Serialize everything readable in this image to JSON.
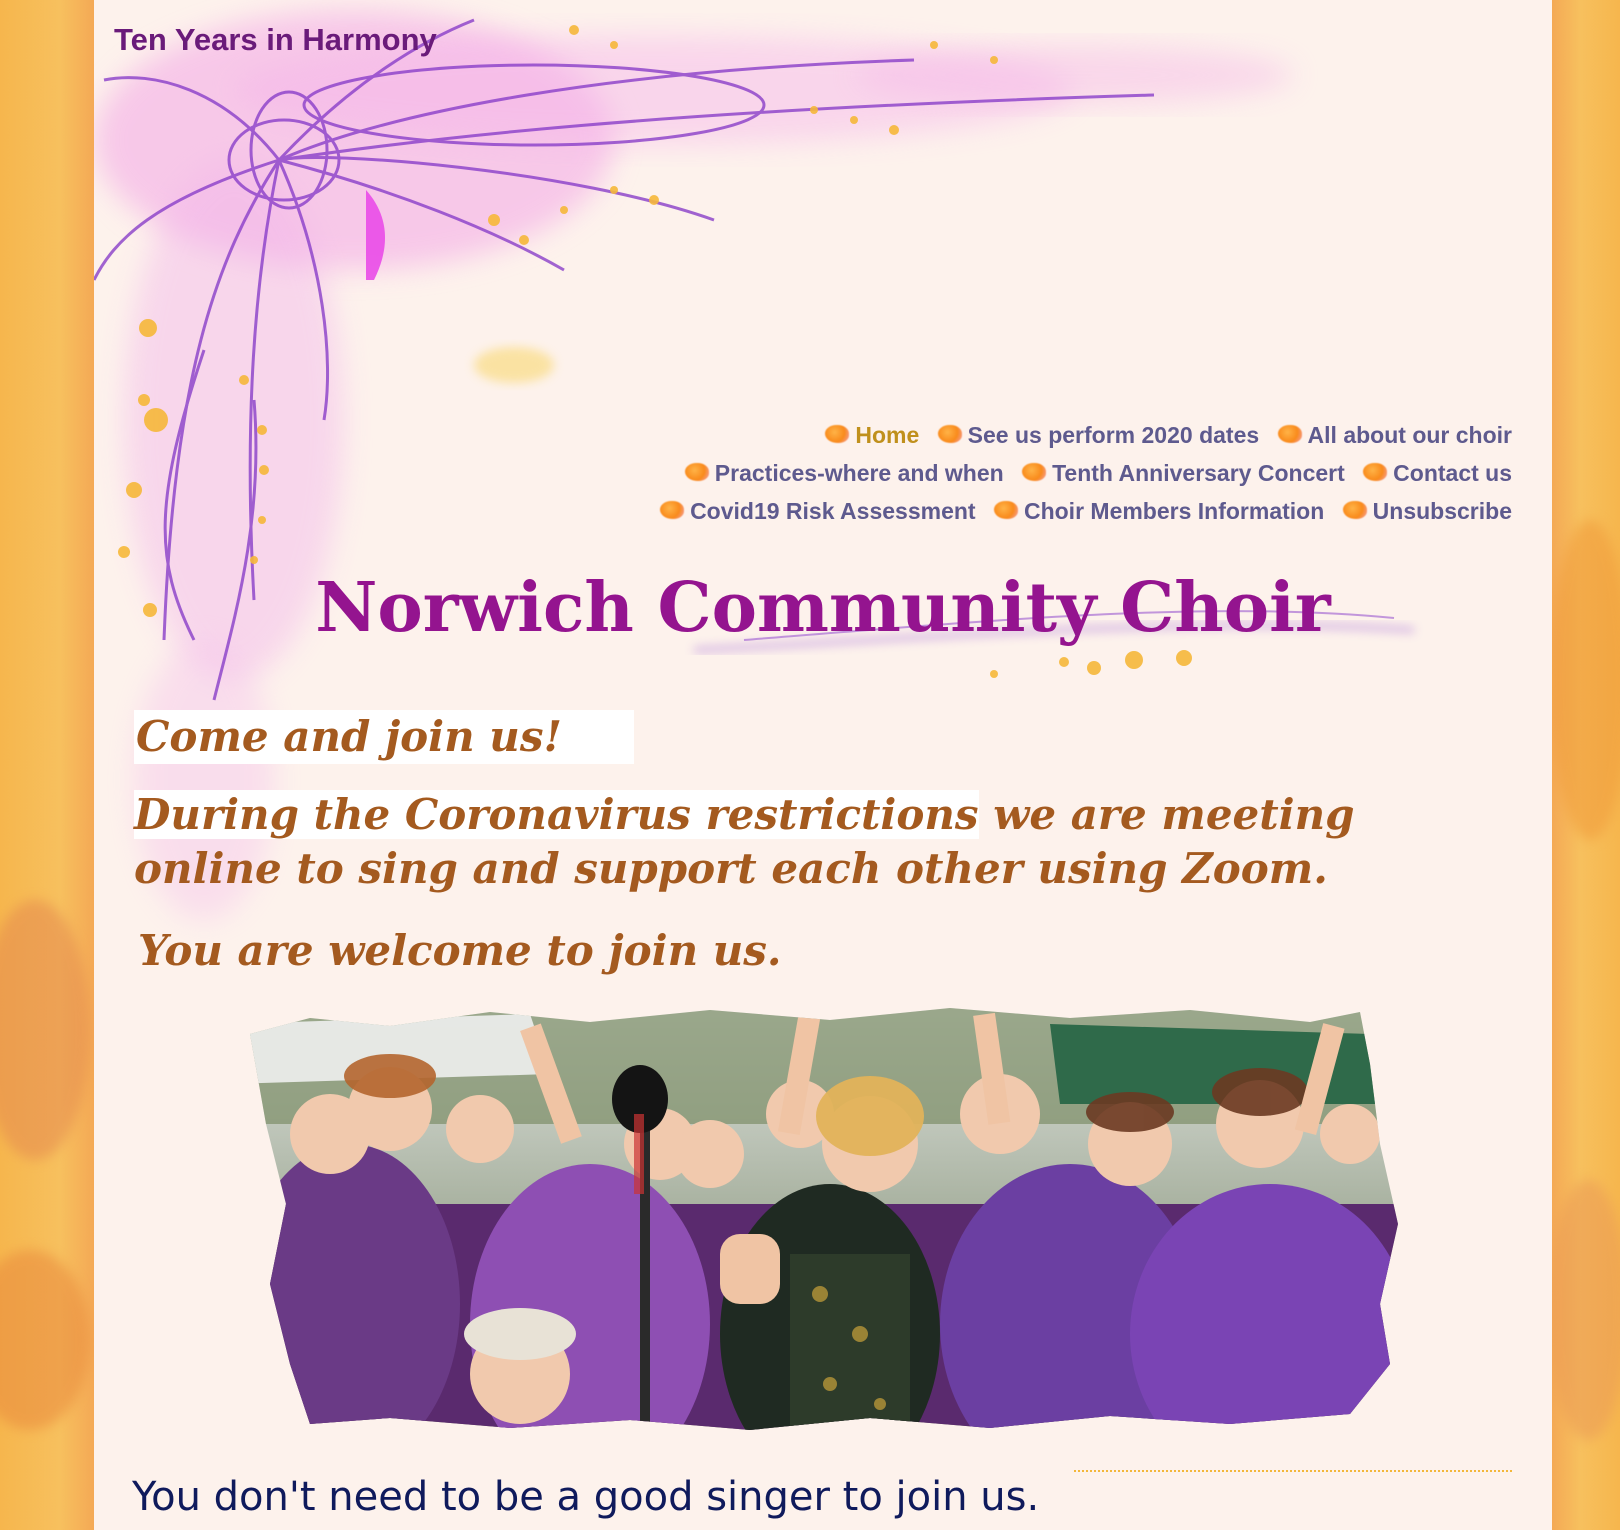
{
  "site": {
    "tagline": "Ten Years in Harmony"
  },
  "nav": {
    "items": [
      {
        "label": "Home",
        "active": true
      },
      {
        "label": "See us perform 2020 dates",
        "active": false
      },
      {
        "label": "All about our choir",
        "active": false
      },
      {
        "label": "Practices-where and when",
        "active": false
      },
      {
        "label": "Tenth Anniversary Concert",
        "active": false
      },
      {
        "label": "Contact us",
        "active": false
      },
      {
        "label": "Covid19 Risk Assessment",
        "active": false
      },
      {
        "label": "Choir Members Information",
        "active": false
      },
      {
        "label": "Unsubscribe",
        "active": false
      }
    ],
    "bullet_icon": "orange-blob-icon"
  },
  "main": {
    "title": "Norwich Community Choir",
    "come_join": "Come and join us!",
    "covid_highlight": "During the Coronavirus restrictions",
    "covid_rest": " we are meeting online to sing and support each other using Zoom.",
    "welcome": "You are welcome to join us.",
    "photo": "choir-photo",
    "lead_text": "You don't need to be a good singer to join us."
  },
  "colors": {
    "title": "#94148f",
    "nav_link": "#5e5a8e",
    "nav_active": "#c0901c",
    "intro_text": "#a45a1f",
    "page_bg": "#fdf2ec",
    "outer_bg": "#f6b64d"
  }
}
